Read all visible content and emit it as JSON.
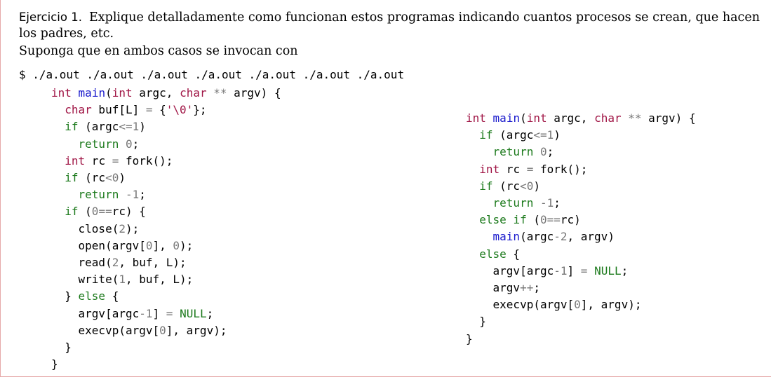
{
  "exercise": {
    "label": "Ejercicio 1.",
    "statement": "Explique detalladamente como funcionan estos programas indicando cuantos procesos se crean, que hacen los padres, etc.",
    "invocation_note": "Suponga que en ambos casos se invocan con"
  },
  "command_line": "$ ./a.out ./a.out ./a.out ./a.out ./a.out ./a.out ./a.out",
  "program_left": {
    "lines": [
      "int main(int argc, char ** argv) {",
      "  char buf[L] = {'\\0'};",
      "  if (argc<=1)",
      "    return 0;",
      "  int rc = fork();",
      "  if (rc<0)",
      "    return -1;",
      "  if (0==rc) {",
      "    close(2);",
      "    open(argv[0], 0);",
      "    read(2, buf, L);",
      "    write(1, buf, L);",
      "  } else {",
      "    argv[argc-1] = NULL;",
      "    execvp(argv[0], argv);",
      "  }",
      "}"
    ]
  },
  "program_right": {
    "lines": [
      "int main(int argc, char ** argv) {",
      "  if (argc<=1)",
      "    return 0;",
      "  int rc = fork();",
      "  if (rc<0)",
      "    return -1;",
      "  else if (0==rc)",
      "    main(argc-2, argv)",
      "  else {",
      "    argv[argc-1] = NULL;",
      "    argv++;",
      "    execvp(argv[0], argv);",
      "  }",
      "}"
    ]
  },
  "colors": {
    "keyword": "#1c7a1c",
    "type": "#a01545",
    "function": "#1a1acc",
    "number": "#777777",
    "border": "#e6a8a8"
  }
}
